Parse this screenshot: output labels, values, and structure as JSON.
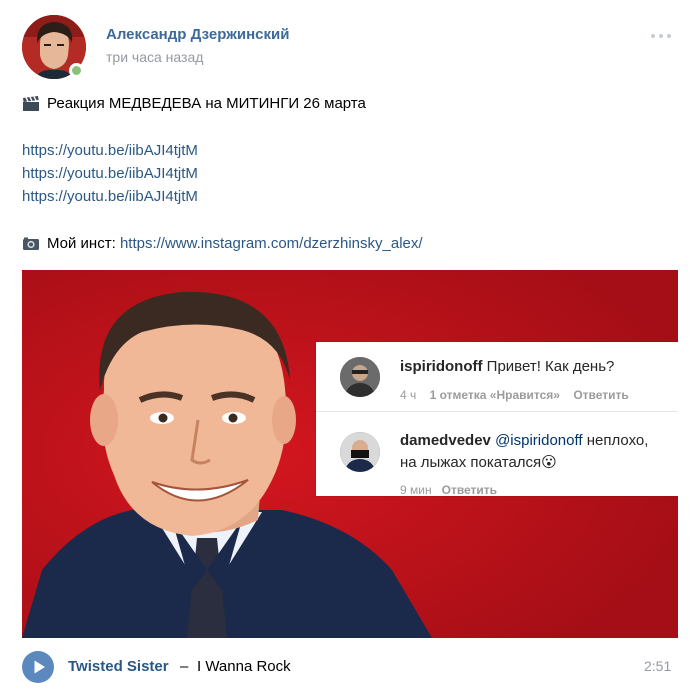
{
  "author": {
    "name": "Александр Дзержинский",
    "time": "три часа назад",
    "online": true
  },
  "post": {
    "title_line": "Реакция МЕДВЕДЕВА на МИТИНГИ 26 марта",
    "title_icon": "clapperboard-icon",
    "links": [
      "https://youtu.be/iibAJI4tjtM",
      "https://youtu.be/iibAJI4tjtM",
      "https://youtu.be/iibAJI4tjtM"
    ],
    "insta_icon": "camera-icon",
    "insta_label": "Мой инст:",
    "insta_link": "https://www.instagram.com/dzerzhinsky_alex/"
  },
  "image": {
    "background_color": "#c1121b",
    "comments": [
      {
        "user": "ispiridonoff",
        "text": "Привет! Как день?",
        "time": "4 ч",
        "likes": "1 отметка «Нравится»",
        "reply": "Ответить"
      },
      {
        "user": "damedvedev",
        "mention": "@ispiridonoff",
        "text_line1": "неплохо,",
        "text_line2": "на лыжах покатался",
        "emoji": "😮",
        "time": "9 мин",
        "reply": "Ответить"
      }
    ]
  },
  "audio": {
    "artist": "Twisted Sister",
    "separator": "–",
    "title": "I Wanna Rock",
    "duration": "2:51"
  },
  "colors": {
    "link": "#2a5885",
    "author": "#3e6a99",
    "muted": "#939aa3",
    "play_button": "#5b88bd",
    "online": "#8ac176"
  }
}
